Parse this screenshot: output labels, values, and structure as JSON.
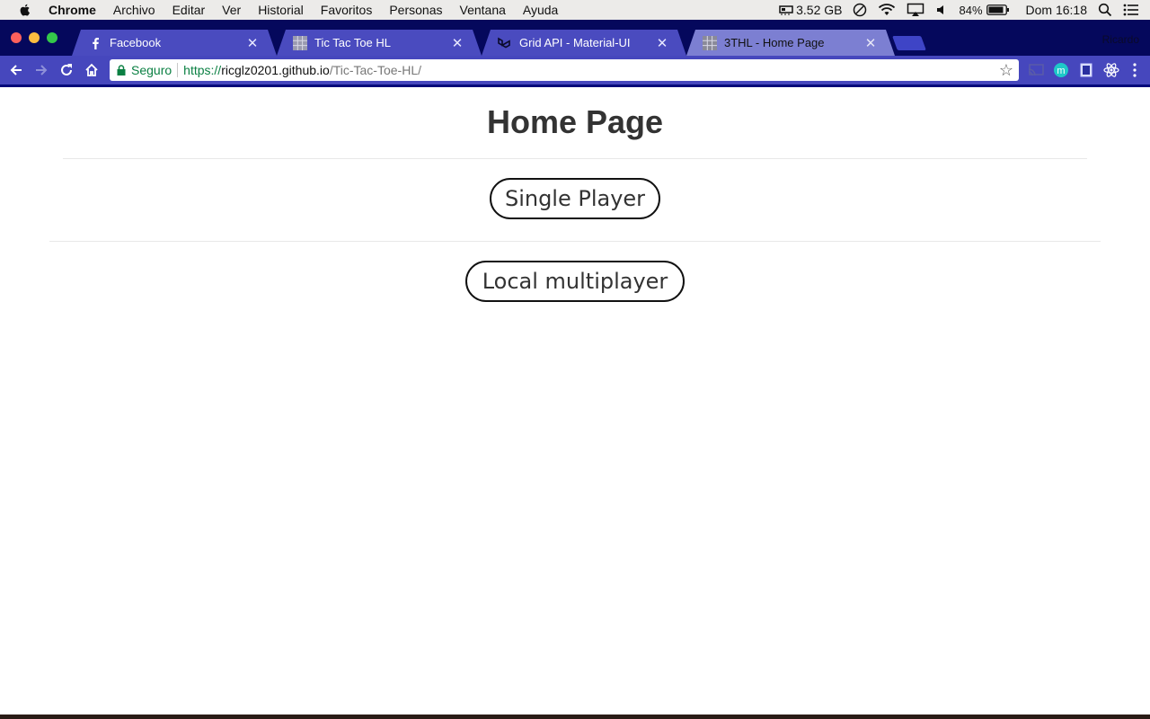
{
  "menubar": {
    "app": "Chrome",
    "items": [
      "Archivo",
      "Editar",
      "Ver",
      "Historial",
      "Favoritos",
      "Personas",
      "Ventana",
      "Ayuda"
    ],
    "memory": "3.52 GB",
    "battery": "84%",
    "clock": "Dom 16:18"
  },
  "browser": {
    "tabs": [
      {
        "title": "Facebook",
        "icon": "facebook-icon"
      },
      {
        "title": "Tic Tac Toe HL",
        "icon": "grid-favicon"
      },
      {
        "title": "Grid API - Material-UI",
        "icon": "material-ui-icon"
      },
      {
        "title": "3THL - Home Page",
        "icon": "grid-favicon",
        "active": true
      }
    ],
    "profile": "Ricardo",
    "omnibox": {
      "secure_label": "Seguro",
      "url_scheme": "https://",
      "url_host": "ricglz0201.github.io",
      "url_path": "/Tic-Tac-Toe-HL/"
    }
  },
  "page": {
    "title": "Home Page",
    "buttons": {
      "single": "Single Player",
      "multi": "Local multiplayer"
    }
  },
  "colors": {
    "tabstrip": "#05085c",
    "toolbar": "#4647bd",
    "active_tab": "#7c7fd2",
    "secure_green": "#0b8043"
  }
}
